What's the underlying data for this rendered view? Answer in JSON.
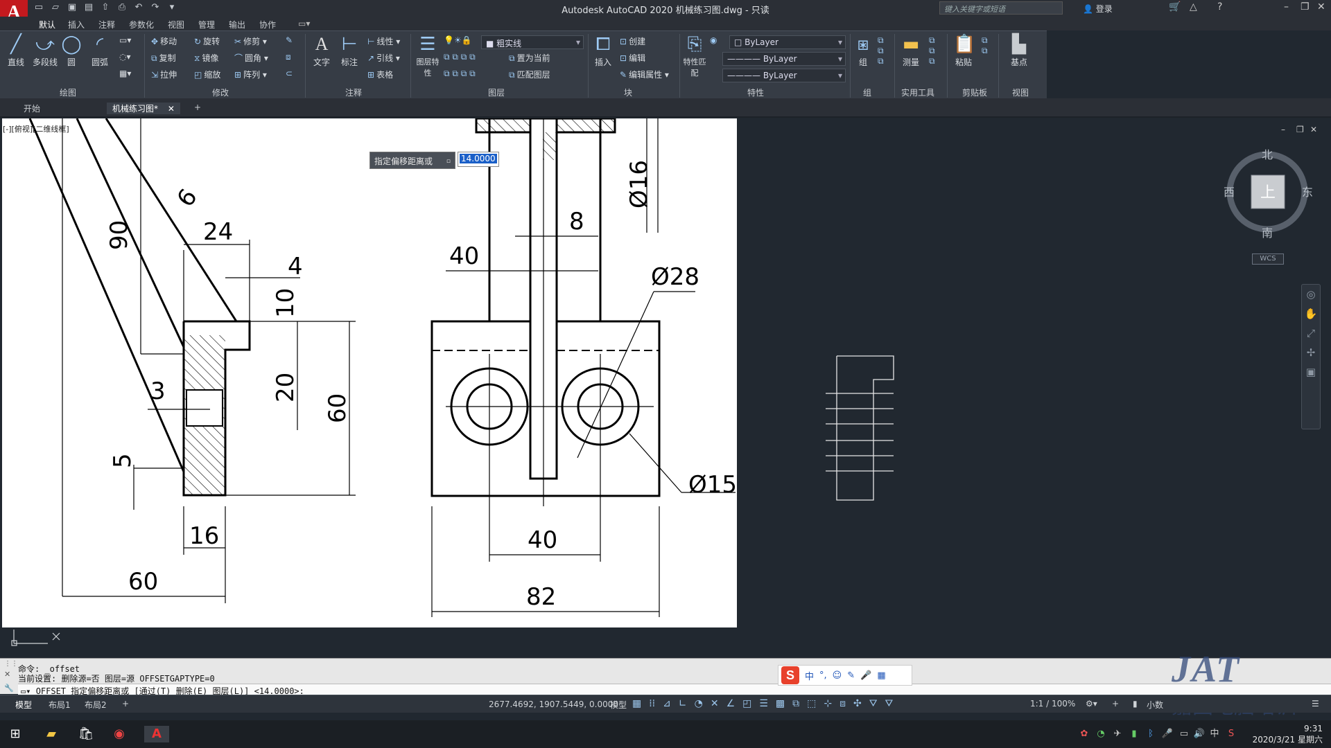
{
  "app": {
    "title": "Autodesk AutoCAD 2020   机械练习图.dwg - 只读",
    "logo": "A",
    "search_placeholder": "键入关键字或短语",
    "login": "登录"
  },
  "ribbon_tabs": [
    "默认",
    "插入",
    "注释",
    "参数化",
    "视图",
    "管理",
    "输出",
    "协作"
  ],
  "ribbon": {
    "draw": {
      "title": "绘图",
      "line": "直线",
      "polyline": "多段线",
      "circle": "圆",
      "arc": "圆弧"
    },
    "modify": {
      "title": "修改",
      "move": "移动",
      "rotate": "旋转",
      "trim": "修剪",
      "copy": "复制",
      "mirror": "镜像",
      "fillet": "圆角",
      "stretch": "拉伸",
      "scale": "缩放",
      "array": "阵列"
    },
    "annotation": {
      "title": "注释",
      "text": "文字",
      "dimension": "标注",
      "linear": "线性",
      "leader": "引线",
      "table": "表格"
    },
    "layers": {
      "title": "图层",
      "properties": "图层特性",
      "current_layer": "粗实线",
      "make_current": "置为当前",
      "match_layer": "匹配图层"
    },
    "block": {
      "title": "块",
      "insert": "插入",
      "create": "创建",
      "edit": "编辑",
      "edit_attributes": "编辑属性"
    },
    "properties": {
      "title": "特性",
      "match": "特性匹配",
      "color": "ByLayer",
      "linetype": "ByLayer",
      "lineweight": "ByLayer"
    },
    "groups": {
      "title": "组",
      "group": "组"
    },
    "utilities": {
      "title": "实用工具",
      "measure": "测量"
    },
    "clipboard": {
      "title": "剪贴板",
      "paste": "粘贴"
    },
    "view": {
      "title": "视图",
      "base": "基点"
    }
  },
  "doc_tabs": [
    "开始",
    "机械练习图*"
  ],
  "viewport_label": "[-][俯视][二维线框]",
  "offset_prompt": {
    "label": "指定偏移距离或",
    "value": "14.0000"
  },
  "nav_cube": {
    "north": "北",
    "south": "南",
    "east": "东",
    "west": "西",
    "top": "上",
    "wcs": "WCS"
  },
  "dims": {
    "d90": "90",
    "d6": "6",
    "d24": "24",
    "d4": "4",
    "d10": "10",
    "d3": "3",
    "d20": "20",
    "d60v": "60",
    "d5": "5",
    "d16": "16",
    "d60": "60",
    "d8": "8",
    "d40top": "40",
    "phi16": "Ø16",
    "phi28": "Ø28",
    "phi15": "Ø15",
    "d40bot": "40",
    "d82": "82"
  },
  "command": {
    "line1": "命令: _offset",
    "line2": "当前设置: 删除源=否  图层=源  OFFSETGAPTYPE=0",
    "input": "OFFSET 指定偏移距离或 [通过(T) 删除(E) 图层(L)] <14.0000>:"
  },
  "layout_tabs": [
    "模型",
    "布局1",
    "布局2"
  ],
  "status": {
    "coords": "2677.4692, 1907.5449, 0.0000",
    "model": "模型",
    "scale": "1:1 / 100%",
    "units": "小数"
  },
  "ime": {
    "lang": "中"
  },
  "clock": {
    "time": "9:31",
    "date": "2020/3/21 星期六"
  },
  "watermark": {
    "brand": "JAT",
    "sub": "嘉图电脑培训"
  }
}
